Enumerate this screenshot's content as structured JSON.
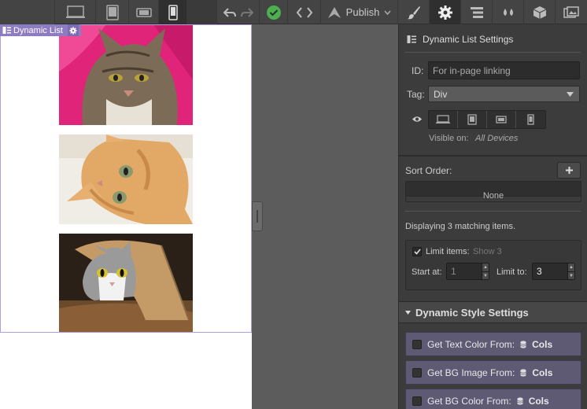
{
  "toolbar": {
    "publish_label": "Publish"
  },
  "canvas": {
    "element_tag_label": "Dynamic List"
  },
  "panel": {
    "settings_title": "Dynamic List Settings",
    "id_label": "ID:",
    "id_placeholder": "For in-page linking",
    "tag_label": "Tag:",
    "tag_value": "Div",
    "visible_on_label": "Visible on:",
    "visible_on_value": "All Devices",
    "sort_order_label": "Sort Order:",
    "sort_order_value": "None",
    "matching_text": "Displaying 3 matching items.",
    "limit_items_label": "Limit items:",
    "limit_items_hint": "Show 3",
    "start_at_label": "Start at:",
    "start_at_value": "1",
    "limit_to_label": "Limit to:",
    "limit_to_value": "3"
  },
  "dynamic_style": {
    "title": "Dynamic Style Settings",
    "rows": [
      {
        "label": "Get Text Color From:",
        "source": "Cols"
      },
      {
        "label": "Get BG Image From:",
        "source": "Cols"
      },
      {
        "label": "Get BG Color From:",
        "source": "Cols"
      }
    ]
  },
  "colors": {
    "accent_purple": "#8e7cc3",
    "panel_bg": "#3c3c3c",
    "publish_check": "#4caf50"
  }
}
